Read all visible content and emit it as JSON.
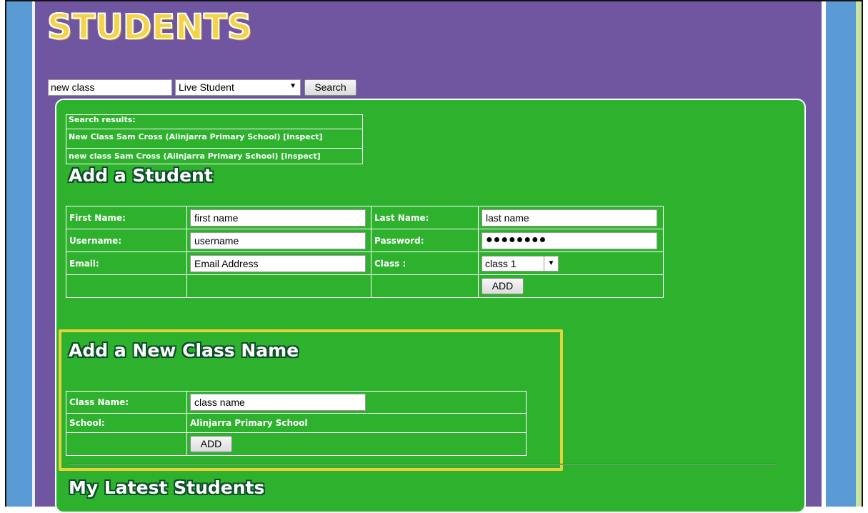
{
  "header": {
    "logo_text": "STUDENTS"
  },
  "search": {
    "query_value": "new class",
    "type_select_value": "Live Student",
    "button_label": "Search"
  },
  "results": {
    "title": "Search results:",
    "items": [
      "New Class Sam Cross (Alinjarra Primary School) [inspect]",
      "new class  Sam Cross (Alinjarra Primary School) [inspect]"
    ]
  },
  "add_student": {
    "heading": "Add a Student",
    "first_name_label": "First Name:",
    "first_name_value": "first name",
    "last_name_label": "Last Name:",
    "last_name_value": "last name",
    "username_label": "Username:",
    "username_value": "username",
    "password_label": "Password:",
    "password_value": "●●●●●●●●",
    "email_label": "Email:",
    "email_value": "Email Address",
    "class_label": "Class :",
    "class_value": "class 1",
    "add_label": "ADD"
  },
  "add_class": {
    "heading": "Add a New Class Name",
    "class_name_label": "Class Name:",
    "class_name_value": "class name",
    "school_label": "School:",
    "school_value": "Alinjarra Primary School",
    "add_label": "ADD"
  },
  "latest": {
    "heading": "My Latest Students"
  },
  "colors": {
    "purple_bg": "#7055a1",
    "green_panel": "#2eb22e",
    "blue_strip": "#5b9bd5",
    "highlight": "#e8d23c",
    "logo_yellow": "#f4d24a"
  }
}
